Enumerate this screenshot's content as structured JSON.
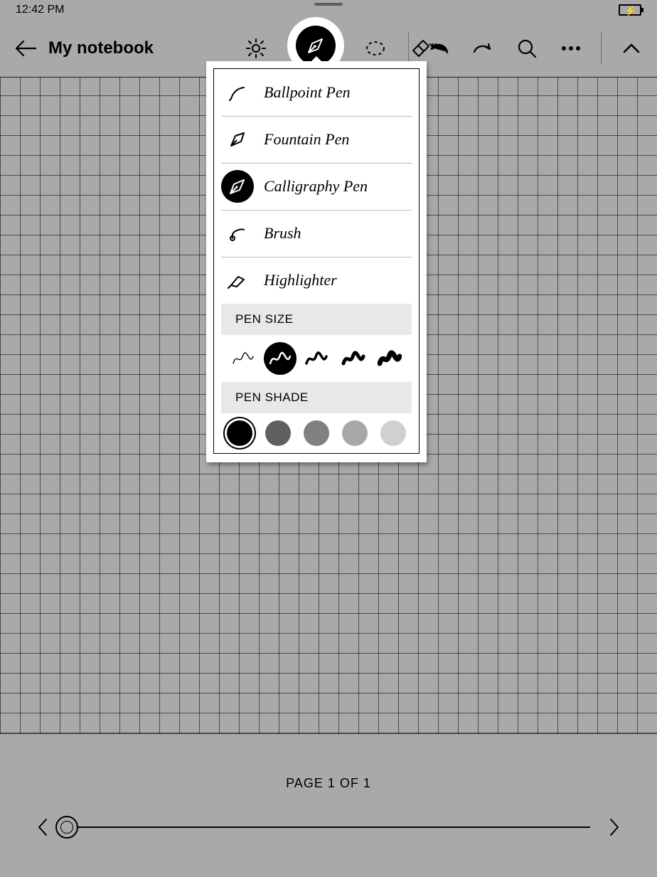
{
  "status": {
    "time": "12:42 PM"
  },
  "header": {
    "title": "My notebook"
  },
  "panel": {
    "pens": [
      {
        "label": "Ballpoint Pen",
        "selected": false
      },
      {
        "label": "Fountain Pen",
        "selected": false
      },
      {
        "label": "Calligraphy Pen",
        "selected": true
      },
      {
        "label": "Brush",
        "selected": false
      },
      {
        "label": "Highlighter",
        "selected": false
      }
    ],
    "sizeTitle": "PEN SIZE",
    "sizes": [
      {
        "w": 1.3,
        "selected": false
      },
      {
        "w": 2.5,
        "selected": true
      },
      {
        "w": 3.5,
        "selected": false
      },
      {
        "w": 5,
        "selected": false
      },
      {
        "w": 7,
        "selected": false
      }
    ],
    "shadeTitle": "PEN SHADE",
    "shades": [
      {
        "hex": "#000000",
        "selected": true
      },
      {
        "hex": "#606060",
        "selected": false
      },
      {
        "hex": "#808080",
        "selected": false
      },
      {
        "hex": "#a8a8a8",
        "selected": false
      },
      {
        "hex": "#d0d0d0",
        "selected": false
      }
    ]
  },
  "footer": {
    "pageLabel": "PAGE 1 OF 1"
  }
}
